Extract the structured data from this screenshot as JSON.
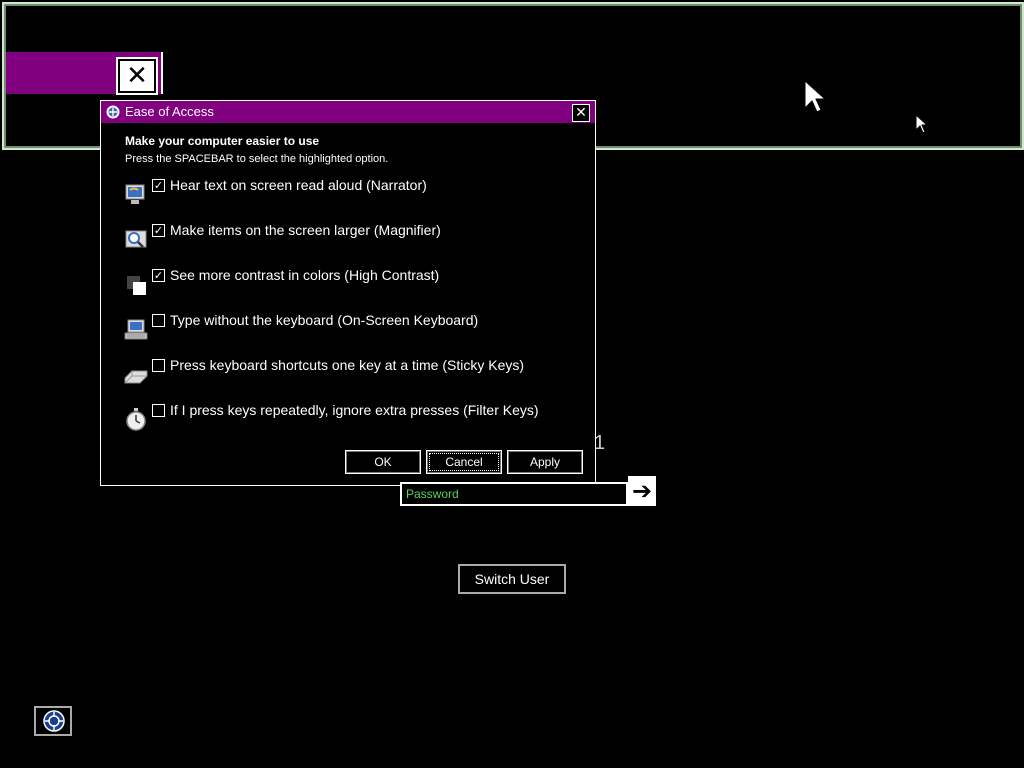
{
  "dialog": {
    "title": "Ease of Access",
    "close_glyph": "✕",
    "heading": "Make your computer easier to use",
    "subtext": "Press the SPACEBAR to select the highlighted option.",
    "options": [
      {
        "label": "Hear text on screen read aloud (Narrator)",
        "checked": true,
        "icon": "narrator-icon"
      },
      {
        "label": "Make items on the screen larger (Magnifier)",
        "checked": true,
        "icon": "magnifier-icon"
      },
      {
        "label": "See more contrast in colors (High Contrast)",
        "checked": true,
        "icon": "high-contrast-icon"
      },
      {
        "label": "Type without the keyboard (On-Screen Keyboard)",
        "checked": false,
        "icon": "on-screen-keyboard-icon"
      },
      {
        "label": "Press keyboard shortcuts one key at a time (Sticky Keys)",
        "checked": false,
        "icon": "sticky-keys-icon"
      },
      {
        "label": "If I press keys repeatedly, ignore extra presses (Filter Keys)",
        "checked": false,
        "icon": "filter-keys-icon"
      }
    ],
    "buttons": {
      "ok": "OK",
      "cancel": "Cancel",
      "apply": "Apply"
    }
  },
  "background_window": {
    "close_glyph": "✕"
  },
  "stray_text": "1",
  "login": {
    "password_placeholder": "Password",
    "submit_glyph": "➔",
    "switch_user_label": "Switch User"
  },
  "colors": {
    "titlebar": "#800080",
    "password_text": "#5bd35b",
    "window_border": "#cfe8cf"
  }
}
